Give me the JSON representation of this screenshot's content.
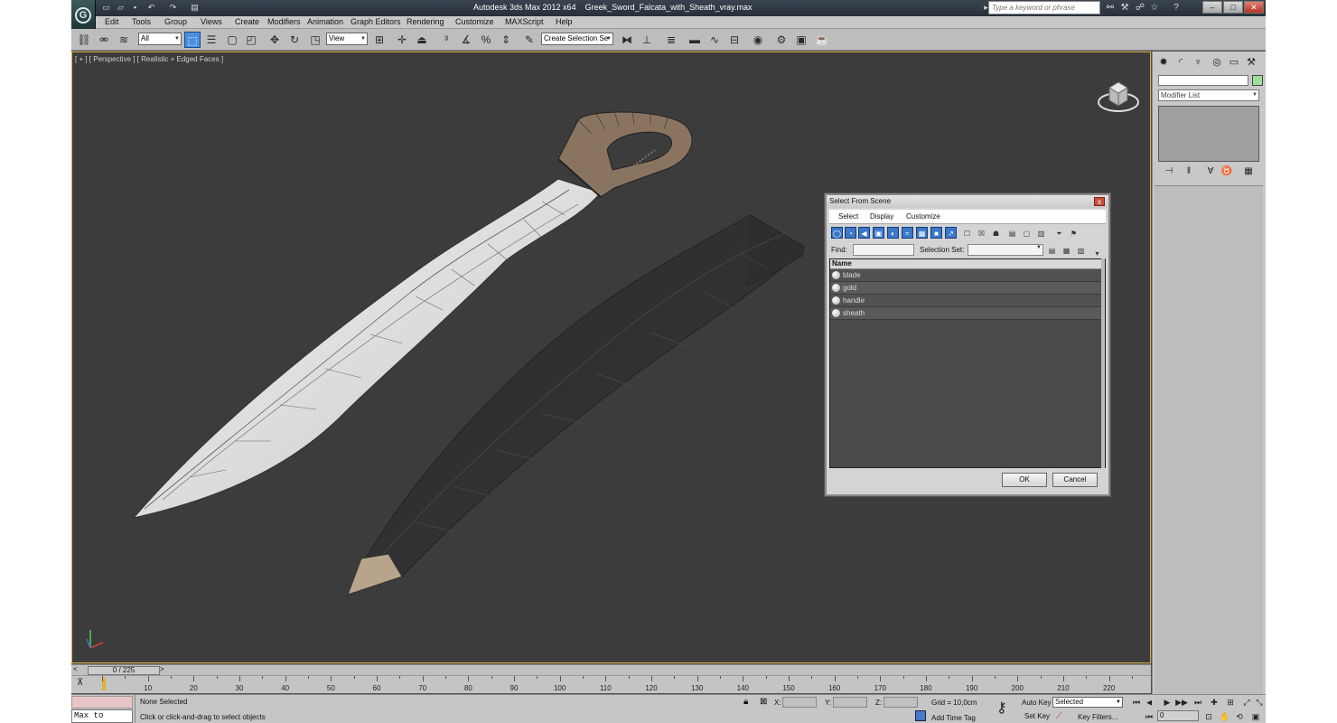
{
  "title": {
    "app": "Autodesk 3ds Max 2012 x64",
    "file": "Greek_Sword_Falcata_with_Sheath_vray.max",
    "search_placeholder": "Type a keyword or phrase"
  },
  "menubar": [
    "Edit",
    "Tools",
    "Group",
    "Views",
    "Create",
    "Modifiers",
    "Animation",
    "Graph Editors",
    "Rendering",
    "Customize",
    "MAXScript",
    "Help"
  ],
  "toolbar": {
    "filter_value": "All",
    "ref_coord_value": "View",
    "named_selection_placeholder": "Create Selection Se"
  },
  "viewport": {
    "label": "[ + ] [ Perspective ] [ Realistic + Edged Faces ]"
  },
  "command_panel": {
    "modifier_list": "Modifier List",
    "object_color": "#9ce09c"
  },
  "dialog": {
    "title": "Select From Scene",
    "close_label": "x",
    "menu": [
      "Select",
      "Display",
      "Customize"
    ],
    "find_label": "Find:",
    "selection_set_label": "Selection Set:",
    "column_name": "Name",
    "items": [
      "blade",
      "gold",
      "handle",
      "sheath"
    ],
    "ok_label": "OK",
    "cancel_label": "Cancel"
  },
  "timeline": {
    "frame_display": "0 / 225",
    "ticks": [
      10,
      20,
      30,
      40,
      50,
      60,
      70,
      80,
      90,
      100,
      110,
      120,
      130,
      140,
      150,
      160,
      170,
      180,
      190,
      200,
      210,
      220
    ]
  },
  "status": {
    "maxscript_text": "Max to Physc",
    "selection": "None Selected",
    "prompt": "Click or click-and-drag to select objects",
    "x_label": "X:",
    "y_label": "Y:",
    "z_label": "Z:",
    "grid": "Grid = 10,0cm",
    "add_time_tag": "Add Time Tag",
    "auto_key": "Auto Key",
    "set_key": "Set Key",
    "selected_value": "Selected",
    "key_filters": "Key Filters...",
    "current_frame": "0"
  }
}
